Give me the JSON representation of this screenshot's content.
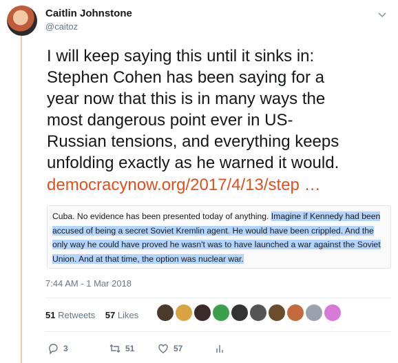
{
  "author": {
    "name": "Caitlin Johnstone",
    "handle": "@caitoz"
  },
  "tweet": {
    "text": "I will keep saying this until it sinks in:\nStephen Cohen has been saying for a\nyear now that this is in many ways the\nmost dangerous point ever in US-\nRussian tensions, and everything keeps\nunfolding exactly as he warned it would.",
    "link": "democracynow.org/2017/4/13/step …"
  },
  "quote": {
    "before": "Cuba. No evidence has been presented today of anything. ",
    "highlighted": "Imagine if Kennedy had been accused of being a secret Soviet Kremlin agent. He would have been crippled. And the only way he could have proved he wasn't was to have launched a war against the Soviet Union. And at that time, the option was nuclear war."
  },
  "timestamp": "7:44 AM - 1 Mar 2018",
  "stats": {
    "retweets_count": "51",
    "retweets_label": "Retweets",
    "likes_count": "57",
    "likes_label": "Likes"
  },
  "liker_avatar_colors": [
    "#4a3b2c",
    "#d9a441",
    "#3b2a2a",
    "#3aa14a",
    "#333333",
    "#555555",
    "#6b4d2e",
    "#c46a3c",
    "#9aa3ad",
    "#d87ad8"
  ],
  "actions": {
    "reply_count": "3",
    "retweet_count": "51",
    "like_count": "57"
  },
  "colors": {
    "link": "#e0501f",
    "thread_line": "#f6c8a3",
    "highlight": "#b3d4fc"
  }
}
